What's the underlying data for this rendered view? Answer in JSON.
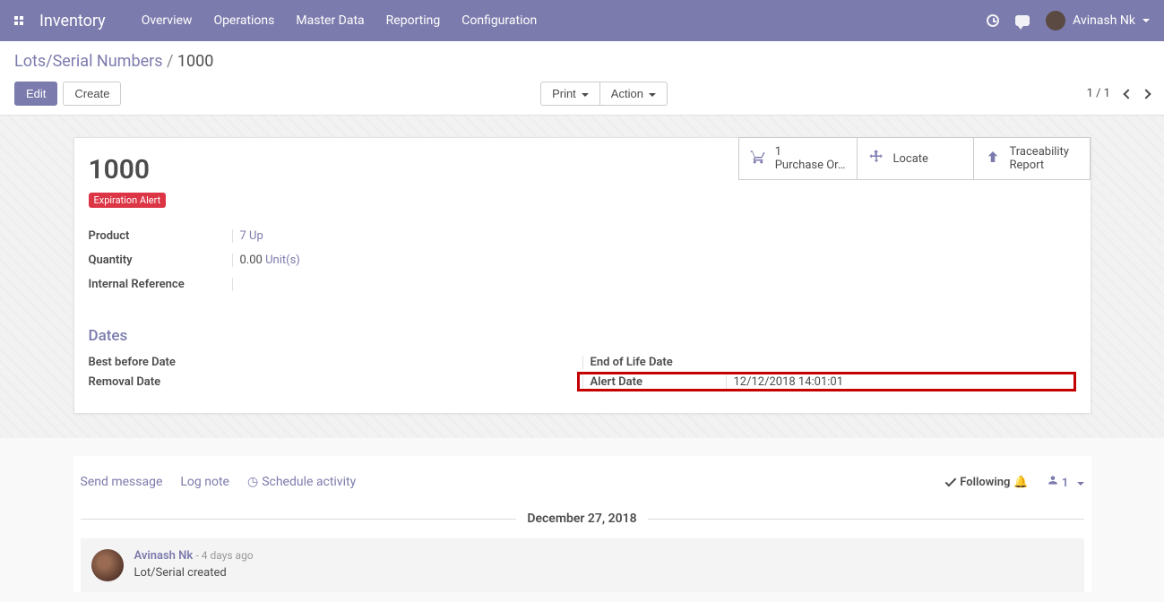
{
  "app": {
    "title": "Inventory",
    "menu": [
      "Overview",
      "Operations",
      "Master Data",
      "Reporting",
      "Configuration"
    ],
    "user": "Avinash Nk"
  },
  "breadcrumb": {
    "parent": "Lots/Serial Numbers",
    "sep": "/",
    "current": "1000"
  },
  "buttons": {
    "edit": "Edit",
    "create": "Create",
    "print": "Print",
    "action": "Action"
  },
  "pager": "1 / 1",
  "stats": {
    "purchase_count": "1",
    "purchase_label": "Purchase Or…",
    "locate": "Locate",
    "trace_line1": "Traceability",
    "trace_line2": "Report"
  },
  "record": {
    "title": "1000",
    "badge": "Expiration Alert",
    "product_label": "Product",
    "product_value": "7 Up",
    "qty_label": "Quantity",
    "qty_value": "0.00",
    "qty_unit": "Unit(s)",
    "ref_label": "Internal Reference"
  },
  "dates": {
    "section": "Dates",
    "best_before": "Best before Date",
    "removal": "Removal Date",
    "eol": "End of Life Date",
    "alert_label": "Alert Date",
    "alert_value": "12/12/2018 14:01:01"
  },
  "chatter": {
    "send": "Send message",
    "log": "Log note",
    "schedule": "Schedule activity",
    "following": "Following",
    "followers_count": "1",
    "date_sep": "December 27, 2018",
    "msg_author": "Avinash Nk",
    "msg_when": "- 4 days ago",
    "msg_content": "Lot/Serial created"
  }
}
